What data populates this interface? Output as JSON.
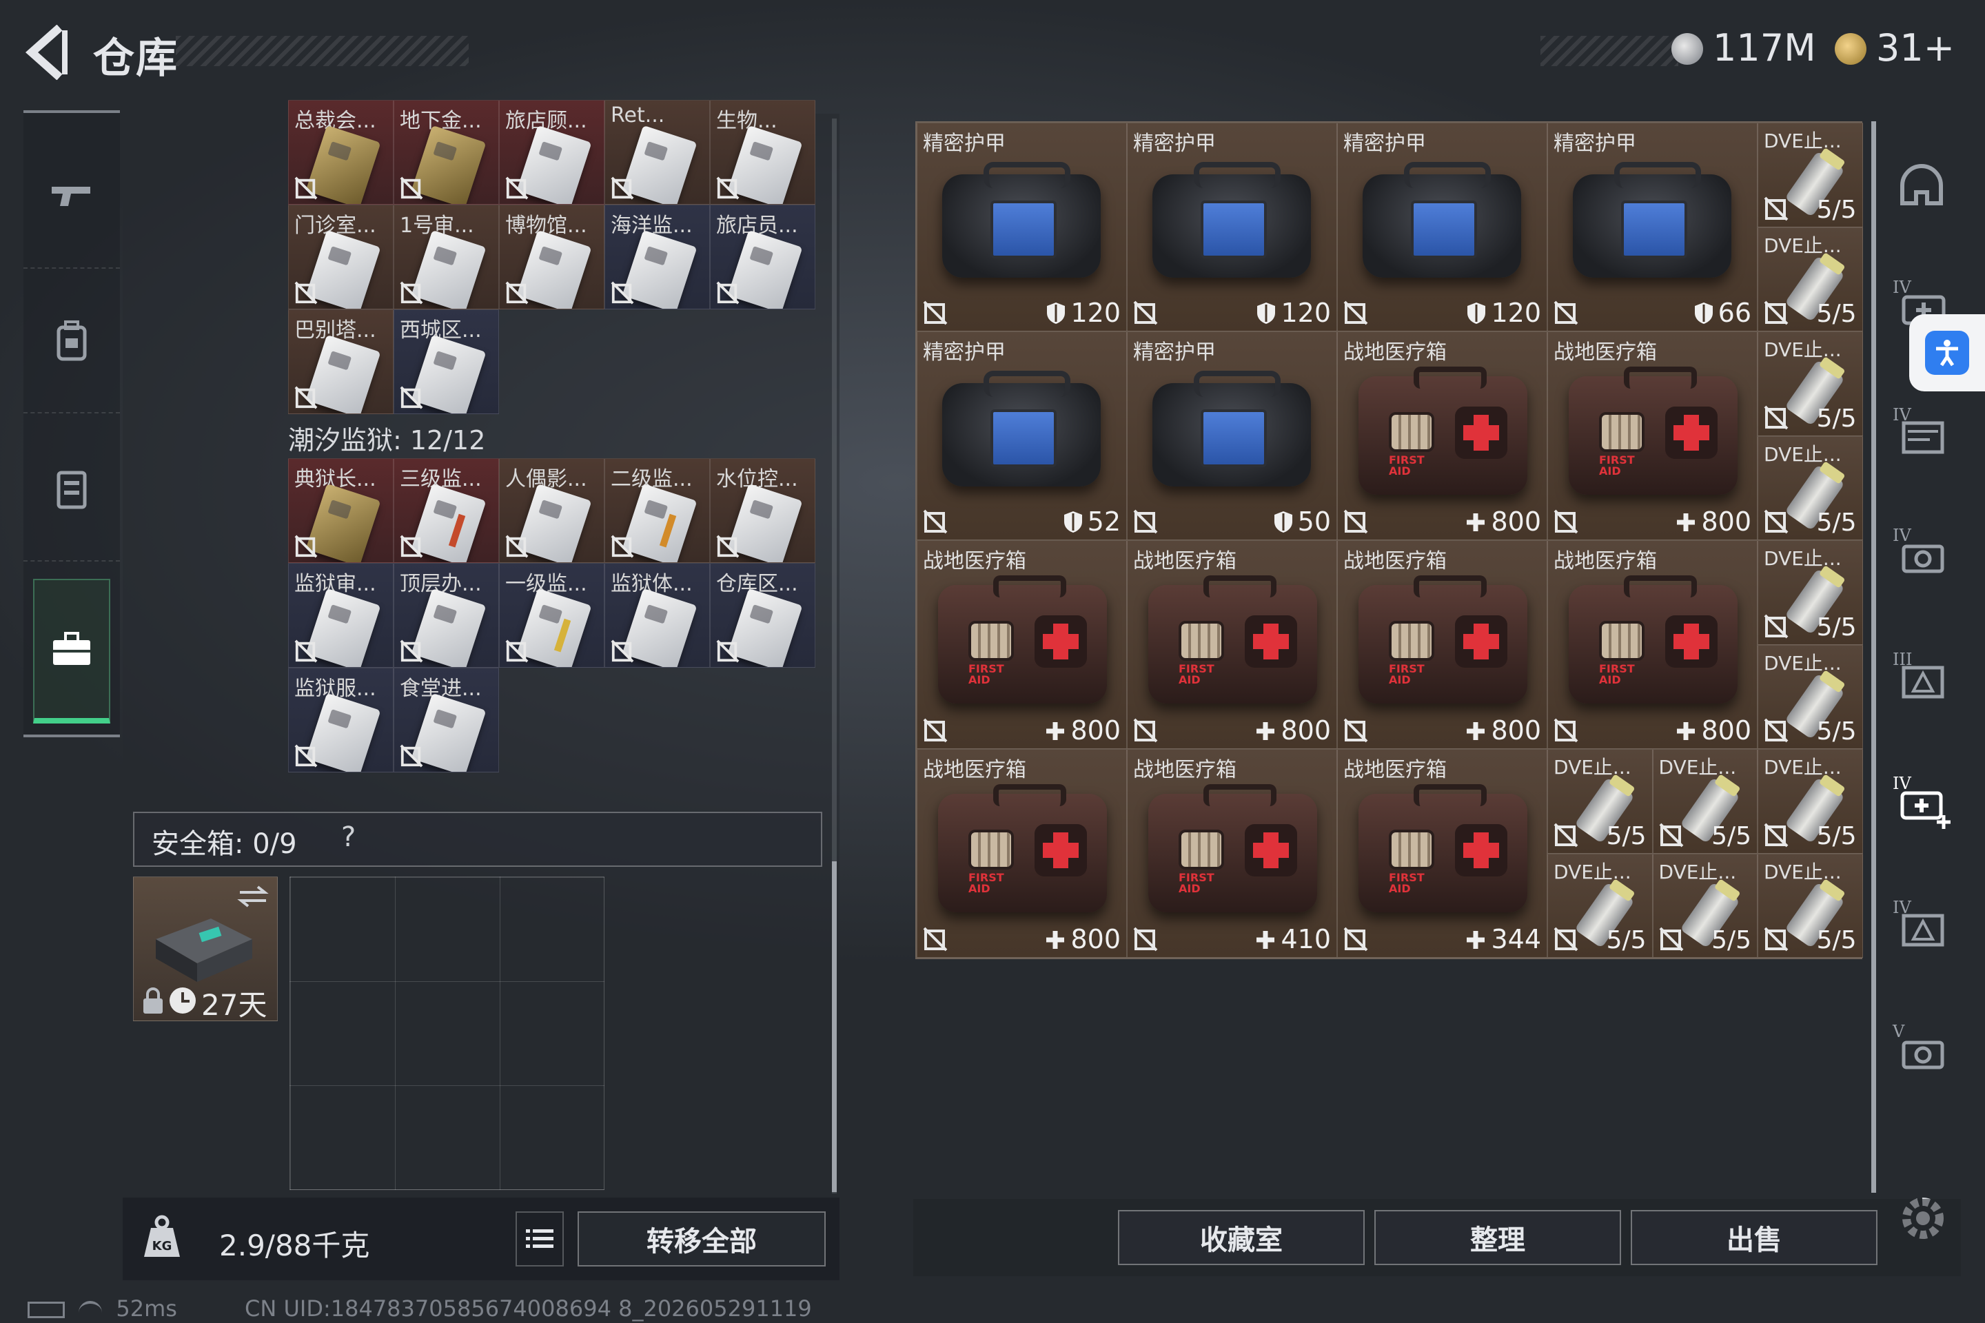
{
  "header": {
    "title": "仓库",
    "currency1": "117M",
    "currency2": "31+"
  },
  "left_nav": [
    "gun-icon",
    "backpack-icon",
    "armor-vest-icon",
    "briefcase-icon"
  ],
  "top_keys": [
    {
      "label": "总裁会...",
      "style": "red",
      "card": "gold"
    },
    {
      "label": "地下金...",
      "style": "red",
      "card": "gold"
    },
    {
      "label": "旅店顾...",
      "style": "red",
      "card": "white"
    },
    {
      "label": "Ret...",
      "style": "brown",
      "card": "white"
    },
    {
      "label": "生物...",
      "style": "brown",
      "card": "white"
    },
    {
      "label": "门诊室...",
      "style": "brown",
      "card": "white"
    },
    {
      "label": "1号审...",
      "style": "brown",
      "card": "white"
    },
    {
      "label": "博物馆...",
      "style": "brown",
      "card": "white"
    },
    {
      "label": "海洋监...",
      "style": "blue",
      "card": "white"
    },
    {
      "label": "旅店员...",
      "style": "blue",
      "card": "white"
    },
    {
      "label": "巴别塔...",
      "style": "brown",
      "card": "white"
    },
    {
      "label": "西城区...",
      "style": "blue",
      "card": "white"
    }
  ],
  "tide_prison": {
    "label": "潮汐监狱: 12/12"
  },
  "prison_keys": [
    {
      "label": "典狱长...",
      "style": "red",
      "card": "gold"
    },
    {
      "label": "三级监...",
      "style": "red",
      "card": "stripe"
    },
    {
      "label": "人偶影...",
      "style": "brown",
      "card": "white"
    },
    {
      "label": "二级监...",
      "style": "brown",
      "card": "stripe2"
    },
    {
      "label": "水位控...",
      "style": "brown",
      "card": "white"
    },
    {
      "label": "监狱审...",
      "style": "blue",
      "card": "white"
    },
    {
      "label": "顶层办...",
      "style": "blue",
      "card": "white"
    },
    {
      "label": "一级监...",
      "style": "blue",
      "card": "stripe3"
    },
    {
      "label": "监狱体...",
      "style": "blue",
      "card": "white"
    },
    {
      "label": "仓库区...",
      "style": "blue",
      "card": "white"
    },
    {
      "label": "监狱服...",
      "style": "blue",
      "card": "white"
    },
    {
      "label": "食堂进...",
      "style": "blue",
      "card": "white"
    }
  ],
  "safe_box": {
    "label": "安全箱: 0/9",
    "help": "?",
    "days": "27天"
  },
  "bottom_left": {
    "weight": "2.9/88千克",
    "transfer_all": "转移全部"
  },
  "inventory": [
    {
      "name": "精密护甲",
      "kind": "armor",
      "value": "120",
      "stat": "shield",
      "col": 0,
      "row": 0
    },
    {
      "name": "精密护甲",
      "kind": "armor",
      "value": "120",
      "stat": "shield",
      "col": 1,
      "row": 0
    },
    {
      "name": "精密护甲",
      "kind": "armor",
      "value": "120",
      "stat": "shield",
      "col": 2,
      "row": 0
    },
    {
      "name": "精密护甲",
      "kind": "armor",
      "value": "66",
      "stat": "shield",
      "col": 3,
      "row": 0
    },
    {
      "name": "精密护甲",
      "kind": "armor",
      "value": "52",
      "stat": "shield",
      "col": 0,
      "row": 1
    },
    {
      "name": "精密护甲",
      "kind": "armor",
      "value": "50",
      "stat": "shield",
      "col": 1,
      "row": 1
    },
    {
      "name": "战地医疗箱",
      "kind": "med",
      "value": "800",
      "stat": "plus",
      "col": 2,
      "row": 1
    },
    {
      "name": "战地医疗箱",
      "kind": "med",
      "value": "800",
      "stat": "plus",
      "col": 3,
      "row": 1
    },
    {
      "name": "战地医疗箱",
      "kind": "med",
      "value": "800",
      "stat": "plus",
      "col": 0,
      "row": 2
    },
    {
      "name": "战地医疗箱",
      "kind": "med",
      "value": "800",
      "stat": "plus",
      "col": 1,
      "row": 2
    },
    {
      "name": "战地医疗箱",
      "kind": "med",
      "value": "800",
      "stat": "plus",
      "col": 2,
      "row": 2
    },
    {
      "name": "战地医疗箱",
      "kind": "med",
      "value": "800",
      "stat": "plus",
      "col": 3,
      "row": 2
    },
    {
      "name": "战地医疗箱",
      "kind": "med",
      "value": "800",
      "stat": "plus",
      "col": 0,
      "row": 3
    },
    {
      "name": "战地医疗箱",
      "kind": "med",
      "value": "410",
      "stat": "plus",
      "col": 1,
      "row": 3
    },
    {
      "name": "战地医疗箱",
      "kind": "med",
      "value": "344",
      "stat": "plus",
      "col": 2,
      "row": 3
    }
  ],
  "small_items": [
    {
      "name": "DVE止...",
      "value": "5/5",
      "col": 8,
      "row": 0
    },
    {
      "name": "DVE止...",
      "value": "5/5",
      "col": 8,
      "row": 1
    },
    {
      "name": "DVE止...",
      "value": "5/5",
      "col": 8,
      "row": 2
    },
    {
      "name": "DVE止...",
      "value": "5/5",
      "col": 8,
      "row": 3
    },
    {
      "name": "DVE止...",
      "value": "5/5",
      "col": 8,
      "row": 4
    },
    {
      "name": "DVE止...",
      "value": "5/5",
      "col": 8,
      "row": 5
    },
    {
      "name": "DVE止...",
      "value": "5/5",
      "col": 6,
      "row": 6
    },
    {
      "name": "DVE止...",
      "value": "5/5",
      "col": 7,
      "row": 6
    },
    {
      "name": "DVE止...",
      "value": "5/5",
      "col": 8,
      "row": 6
    },
    {
      "name": "DVE止...",
      "value": "5/5",
      "col": 6,
      "row": 7
    },
    {
      "name": "DVE止...",
      "value": "5/5",
      "col": 7,
      "row": 7
    },
    {
      "name": "DVE止...",
      "value": "5/5",
      "col": 8,
      "row": 7
    }
  ],
  "right_nav": [
    "helmet-icon",
    "IV-medkit-icon",
    "IV-storage-icon",
    "IV-camera-icon",
    "III-warning-icon",
    "IV-medkit-add-icon",
    "IV-warning-icon",
    "V-camera-icon"
  ],
  "bottom_right": {
    "collection": "收藏室",
    "organize": "整理",
    "sell": "出售"
  },
  "status": {
    "ping": "52ms",
    "uid": "CN UID:18478370585674008694 8_202605291119"
  }
}
